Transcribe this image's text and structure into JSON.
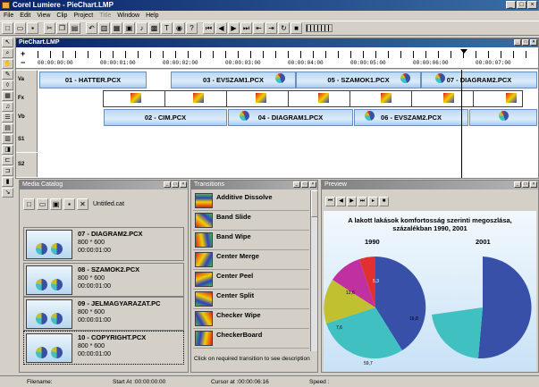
{
  "app": {
    "title": "Corel Lumiere - PieChart.LMP"
  },
  "menu": [
    "File",
    "Edit",
    "View",
    "Clip",
    "Project",
    "Title",
    "Window",
    "Help"
  ],
  "menu_disabled": [
    false,
    false,
    false,
    false,
    false,
    true,
    false,
    false
  ],
  "toolbar": {
    "buttons": [
      "new",
      "open",
      "save",
      "print",
      "cut",
      "copy",
      "paste",
      "undo",
      "clip",
      "film",
      "image",
      "title",
      "audio",
      "movie",
      "preview",
      "help"
    ],
    "transport": [
      "⏮",
      "◀",
      "▶",
      "⏭",
      "⏮",
      "⏭",
      "▶",
      "■"
    ]
  },
  "vertical_tools": [
    "arrow",
    "zoom",
    "hand",
    "pencil",
    "razor",
    "film",
    "sound",
    "list",
    "group",
    "align",
    "mark",
    "snap",
    "trim",
    "lock",
    "next"
  ],
  "timeline": {
    "title": "PieChart.LMP",
    "ticks": [
      "00:00:00:00",
      "00:00:01:00",
      "00:00:02:00",
      "00:00:03:00",
      "00:00:04:00",
      "00:00:05:00",
      "00:00:06:00",
      "00:00:07:00"
    ],
    "tracks": [
      {
        "name": "Va",
        "clips": [
          "01 - HATTER.PCX",
          "03 - EVSZAM1.PCX",
          "05 - SZAMOK1.PCX",
          "07 - DIAGRAM2.PCX"
        ]
      },
      {
        "name": "Fx"
      },
      {
        "name": "Vb",
        "clips": [
          "02 - CIM.PCX",
          "04 - DIAGRAM1.PCX",
          "06 - EVSZAM2.PCX"
        ]
      },
      {
        "name": "S1"
      },
      {
        "name": "S2"
      }
    ]
  },
  "media_catalog": {
    "title": "Media Catalog",
    "filename": "Untitled.cat",
    "items": [
      {
        "name": "07 - DIAGRAM2.PCX",
        "size": "800 * 600",
        "duration": "00:00:01:00"
      },
      {
        "name": "08 - SZAMOK2.PCX",
        "size": "800 * 600",
        "duration": "00:00:01:00"
      },
      {
        "name": "09 - JELMAGYARAZAT.PC",
        "size": "800 * 600",
        "duration": "00:00:01:00"
      },
      {
        "name": "10 - COPYRIGHT.PCX",
        "size": "800 * 600",
        "duration": "00:00:01:00"
      }
    ]
  },
  "transitions": {
    "title": "Transitions",
    "items": [
      "Additive Dissolve",
      "Band Slide",
      "Band Wipe",
      "Center Merge",
      "Center Peel",
      "Center Split",
      "Checker Wipe",
      "CheckerBoard"
    ],
    "hint": "Click on required transition to see description"
  },
  "preview": {
    "title": "Preview",
    "chart_title_1": "A lakott lakások komfortosság szerinti megoszlása,",
    "chart_title_2": "százalékban 1990, 2001",
    "label_1990": "1990",
    "label_2001": "2001",
    "slice_labels": [
      "12,6",
      "7,6",
      "59,7",
      "16,8",
      "5,3"
    ]
  },
  "colors": {
    "blue": "#3950a8",
    "cyan": "#40c0c0",
    "olive": "#c0c030",
    "magenta": "#c030a0",
    "red": "#e03030"
  },
  "status": {
    "filename": "Filename:",
    "start": "Start At :00:00:00:00",
    "cursor": "Cursor at :00:00:06:16",
    "speed": "Speed :"
  }
}
